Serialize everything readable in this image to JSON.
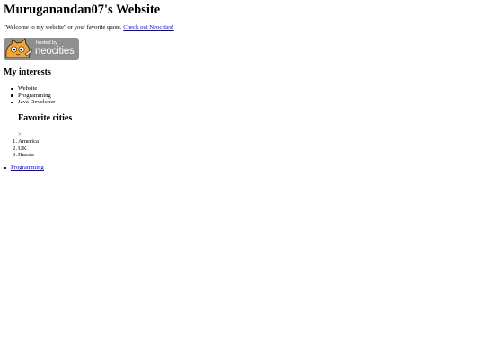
{
  "page": {
    "title": "Muruganandan07's Website",
    "quote": "\"Welcome to my website\" or your favorite quote.",
    "neocities_link": "Check out Neocities!",
    "badge": {
      "small_text": "hosted by",
      "big_text": "neocities"
    }
  },
  "interests": {
    "heading": "My interests",
    "items": [
      "Website",
      "Programming",
      "Java Developer"
    ]
  },
  "cities": {
    "stray_text": ">",
    "heading": "Favorite cities",
    "items": [
      "America",
      "UK",
      "Russia"
    ]
  },
  "bottom_links": [
    "Programming"
  ],
  "colors": {
    "link": "#0000ee",
    "badge_bg": "#8f8f8f",
    "kitty_fill": "#f0a43a"
  }
}
